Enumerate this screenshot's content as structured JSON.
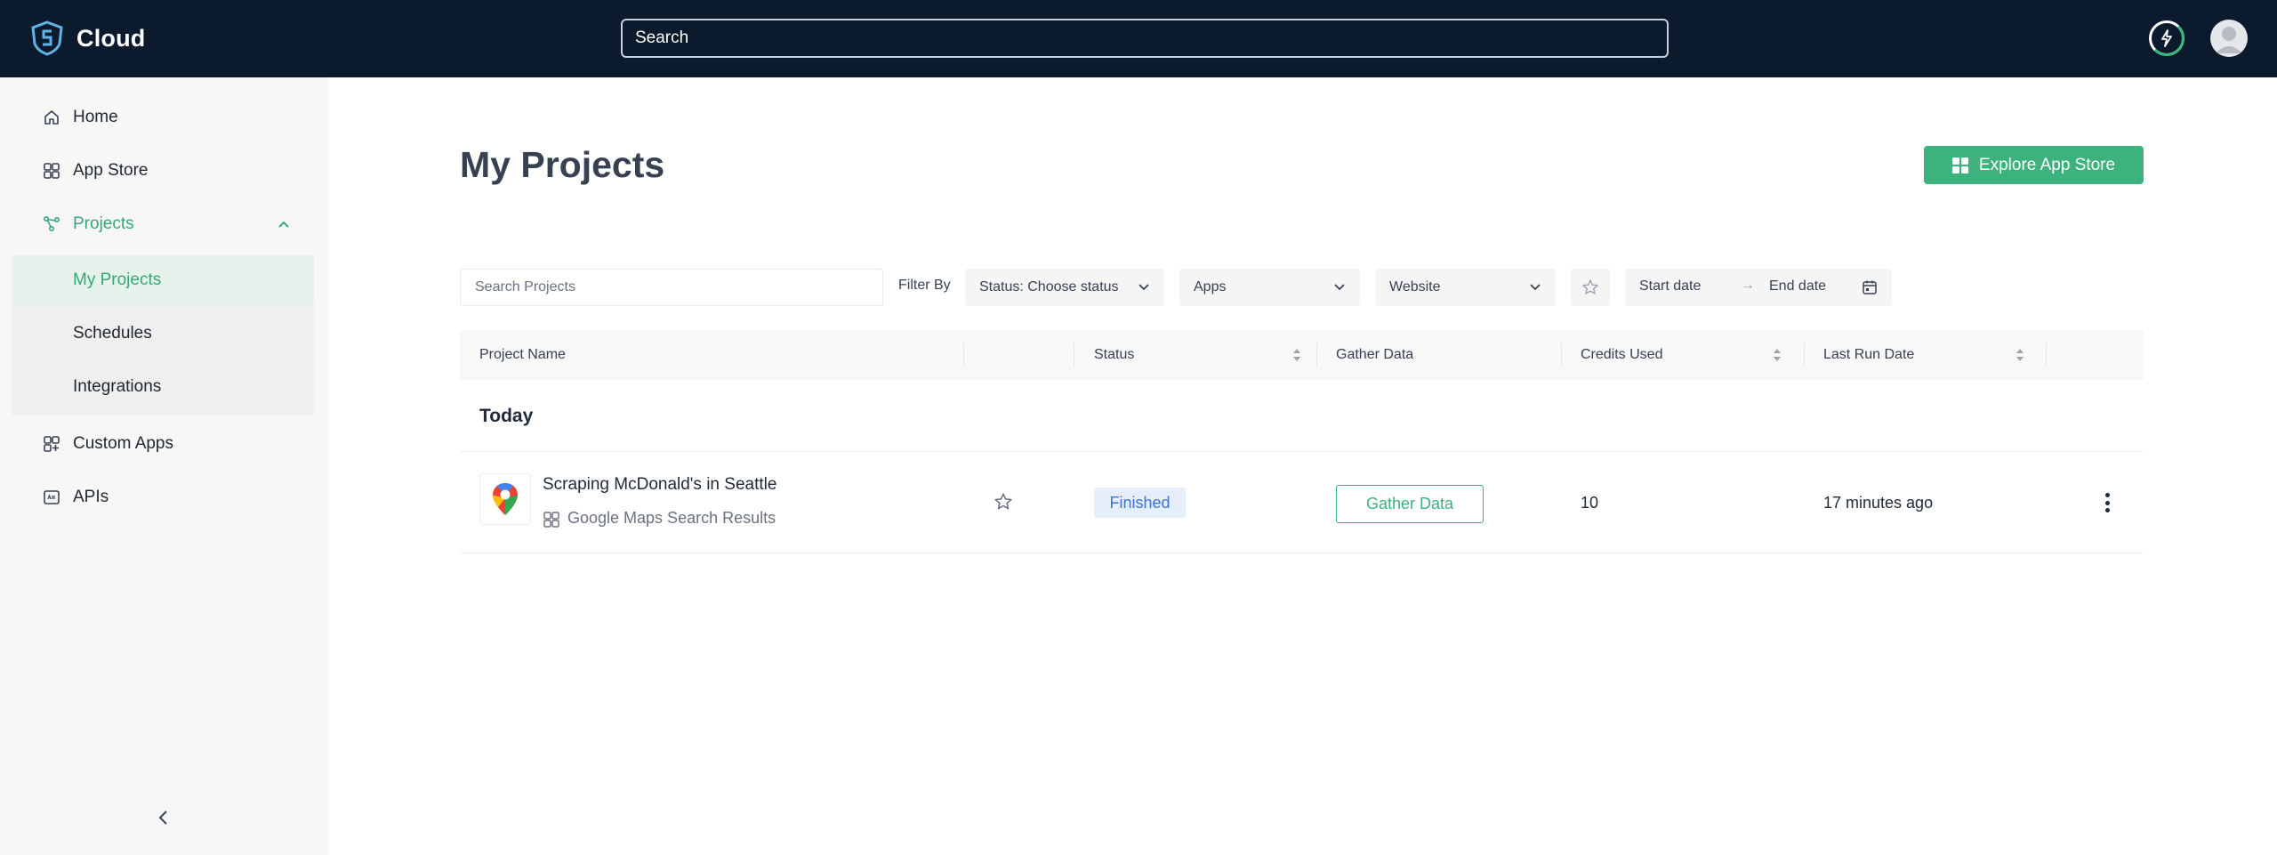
{
  "header": {
    "brand": "Cloud",
    "search_placeholder": "Search",
    "icons": {
      "brand": "shield-logo-icon",
      "credits": "bolt-icon",
      "profile": "avatar"
    }
  },
  "sidebar": {
    "items": [
      {
        "label": "Home",
        "icon": "home-icon"
      },
      {
        "label": "App Store",
        "icon": "grid-icon"
      },
      {
        "label": "Projects",
        "icon": "nodes-icon",
        "expanded": true
      },
      {
        "label": "Custom Apps",
        "icon": "apps-plus-icon"
      },
      {
        "label": "APIs",
        "icon": "api-icon"
      }
    ],
    "sub_items": [
      {
        "label": "My Projects",
        "selected": true
      },
      {
        "label": "Schedules"
      },
      {
        "label": "Integrations"
      }
    ],
    "collapse_icon": "chevron-left-icon"
  },
  "main": {
    "title": "My Projects",
    "explore_button": "Explore App Store",
    "filters": {
      "search_placeholder": "Search Projects",
      "filter_by_label": "Filter By",
      "status": "Status: Choose status",
      "apps": "Apps",
      "website": "Website",
      "start_date": "Start date",
      "arrow": "→",
      "end_date": "End date"
    },
    "table": {
      "columns": [
        "Project Name",
        "Status",
        "Gather Data",
        "Credits Used",
        "Last Run Date"
      ],
      "group": "Today",
      "rows": [
        {
          "name": "Scraping McDonald's in Seattle",
          "app": "Google Maps Search Results",
          "status": "Finished",
          "action": "Gather Data",
          "credits": "10",
          "last_run": "17 minutes ago"
        }
      ]
    }
  },
  "colors": {
    "topbar": "#0c1a2e",
    "accent": "#3db27d",
    "status_badge_bg": "#e6eefc",
    "status_badge_text": "#3b73d6"
  }
}
